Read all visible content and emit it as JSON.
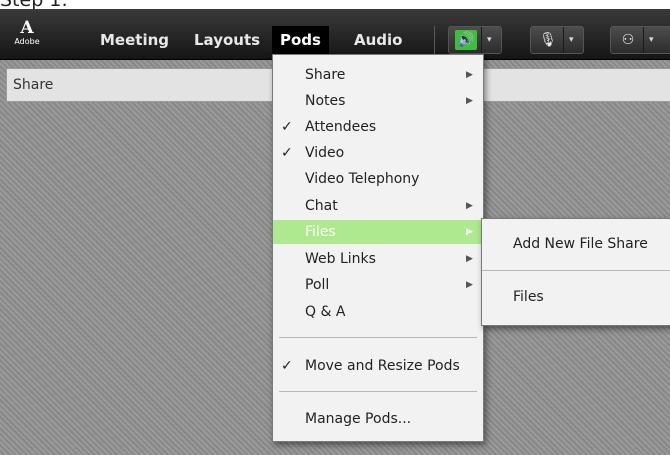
{
  "caption": "Step 1:",
  "app": {
    "logo_text": "Adobe",
    "menu": [
      "Meeting",
      "Layouts",
      "Pods",
      "Audio"
    ],
    "active_menu": "Pods",
    "toolbar": {
      "speaker_icon": "speaker-icon",
      "mic_icon": "microphone-icon",
      "camera_icon": "webcam-icon",
      "caret": "▾",
      "speaker_color": "#3cbf3c"
    }
  },
  "pod": {
    "title": "Share"
  },
  "pods_menu": {
    "items": [
      {
        "label": "Share",
        "checked": false,
        "has_submenu": true
      },
      {
        "label": "Notes",
        "checked": false,
        "has_submenu": true
      },
      {
        "label": "Attendees",
        "checked": true,
        "has_submenu": false
      },
      {
        "label": "Video",
        "checked": true,
        "has_submenu": false
      },
      {
        "label": "Video Telephony",
        "checked": false,
        "has_submenu": false
      },
      {
        "label": "Chat",
        "checked": false,
        "has_submenu": true
      },
      {
        "label": "Files",
        "checked": false,
        "has_submenu": true,
        "highlighted": true
      },
      {
        "label": "Web Links",
        "checked": false,
        "has_submenu": true
      },
      {
        "label": "Poll",
        "checked": false,
        "has_submenu": true
      },
      {
        "label": "Q & A",
        "checked": false,
        "has_submenu": false
      }
    ],
    "move_resize": {
      "label": "Move and Resize Pods",
      "checked": true
    },
    "manage": {
      "label": "Manage Pods..."
    },
    "check_glyph": "✓",
    "arrow_glyph": "▶",
    "highlight_color": "#aee88f"
  },
  "files_submenu": {
    "items": [
      "Add New File Share",
      "Files"
    ]
  }
}
